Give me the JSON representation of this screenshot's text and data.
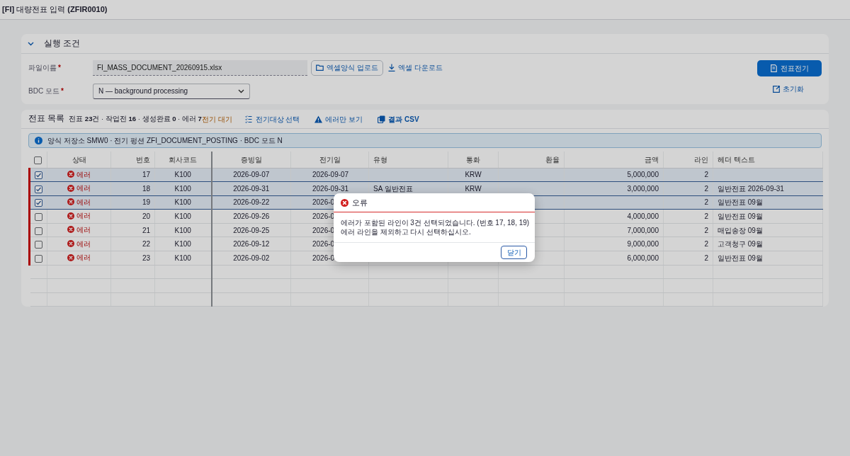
{
  "app_title": "**[FI]** 대량전표 입력 **(ZFIR0010)**",
  "conditions": {
    "title": "실행 조건",
    "expanded": true,
    "fields": [
      {
        "label": "파일이름",
        "required_mark": "*",
        "kind": "file",
        "value": "FI_MASS_DOCUMENT_20260915.xlsx"
      },
      {
        "label": "BDC 모드",
        "required_mark": "*",
        "kind": "select",
        "value": "N — background processing"
      }
    ],
    "upload_button": "엑셀양식 업로드",
    "download_link": "엑셀 다운로드",
    "post_button": "전표전기",
    "reset_link": "초기화"
  },
  "document_list": {
    "title": "전표 목록",
    "summary": "전표 **23**건 · 작업전 **16** · 생성완료 **0** · 에러 **7**",
    "actions": [
      {
        "label": "전기 대기",
        "kind": "status"
      },
      {
        "label": "전기대상 선택",
        "kind": "checklist"
      },
      {
        "label": "에러만 보기",
        "kind": "warning"
      },
      {
        "label": "결과 CSV",
        "kind": "copy"
      }
    ],
    "info": "양식 저장소 SMW0 · 전기 펑션 ZFI_DOCUMENT_POSTING · BDC 모드 N",
    "select_all": {
      "checked": false
    },
    "columns": [
      "상태",
      "번호",
      "회사코드",
      "증빙일",
      "전기일",
      "유형",
      "통화",
      "환율",
      "금액",
      "라인",
      "헤더 텍스트"
    ],
    "rows": [
      {
        "selected": true,
        "status": "에러",
        "error": true,
        "no": "17",
        "company": "K100",
        "doc_date": "2026-09-07",
        "post_date": "2026-09-07",
        "currency": "KRW",
        "amount": "5,000,000",
        "lines": "2"
      },
      {
        "selected": true,
        "status": "에러",
        "error": true,
        "no": "18",
        "company": "K100",
        "doc_date": "2026-09-31",
        "post_date": "2026-09-31",
        "type": "SA 일반전표",
        "currency": "KRW",
        "amount": "3,000,000",
        "lines": "2",
        "header_text": "일반전표 2026-09-31"
      },
      {
        "selected": true,
        "status": "에러",
        "error": true,
        "no": "19",
        "company": "K100",
        "doc_date": "2026-09-22",
        "post_date": "2026-0",
        "lines": "2",
        "header_text": "일반전표 09월"
      },
      {
        "selected": false,
        "status": "에러",
        "error": true,
        "no": "20",
        "company": "K100",
        "doc_date": "2026-09-26",
        "post_date": "2026-0",
        "amount": "4,000,000",
        "lines": "2",
        "header_text": "일반전표 09월"
      },
      {
        "selected": false,
        "status": "에러",
        "error": true,
        "no": "21",
        "company": "K100",
        "doc_date": "2026-09-25",
        "post_date": "2026-0",
        "amount": "7,000,000",
        "lines": "2",
        "header_text": "매입송장 09월"
      },
      {
        "selected": false,
        "status": "에러",
        "error": true,
        "no": "22",
        "company": "K100",
        "doc_date": "2026-09-12",
        "post_date": "2026-0",
        "amount": "9,000,000",
        "lines": "2",
        "header_text": "고객청구 09월"
      },
      {
        "selected": false,
        "status": "에러",
        "error": true,
        "no": "23",
        "company": "K100",
        "doc_date": "2026-09-02",
        "post_date": "2026-0",
        "amount": "6,000,000",
        "lines": "2",
        "header_text": "일반전표 09월"
      }
    ]
  },
  "dialog": {
    "kind": "error",
    "title": "오류",
    "message": [
      "에러가 포함된 라인이 3건 선택되었습니다. (번호 17, 18, 19)",
      "에러 라인을 제외하고 다시 선택하십시오."
    ],
    "close_button": "닫기"
  }
}
